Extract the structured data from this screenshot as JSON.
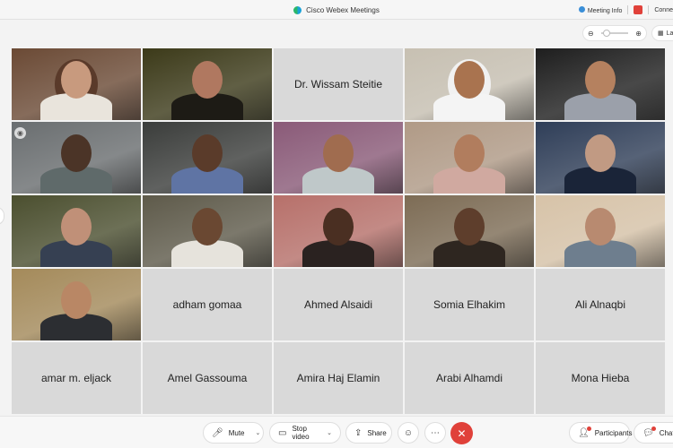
{
  "window": {
    "title": "Cisco Webex Meetings",
    "meeting_info_label": "Meeting Info",
    "connect_label": "Conne"
  },
  "view_controls": {
    "zoom_out_icon": "zoom-out-icon",
    "zoom_in_icon": "zoom-in-icon",
    "layout_label": "La"
  },
  "participants": [
    {
      "type": "video",
      "bg": "#6b4a35",
      "skin": "#c89a7e",
      "cloth": "#e9e4dc",
      "veil": "#5a3a2a"
    },
    {
      "type": "video",
      "bg": "#3c3a19",
      "skin": "#b07860",
      "cloth": "#1d1b15"
    },
    {
      "type": "name",
      "name": "Dr. Wissam Steitie"
    },
    {
      "type": "video",
      "bg": "#c7c0b2",
      "skin": "#a9734f",
      "cloth": "#f4f4f4",
      "veil": "#f1f1f1"
    },
    {
      "type": "video",
      "bg": "#1e1e1e",
      "skin": "#b5815f",
      "cloth": "#9ba0aa"
    },
    {
      "type": "video",
      "bg": "#6a6e70",
      "skin": "#4b3427",
      "cloth": "#5f6a6a",
      "pin": true
    },
    {
      "type": "video",
      "bg": "#3b3d3b",
      "skin": "#5a3b2a",
      "cloth": "#5f74a4"
    },
    {
      "type": "video",
      "bg": "#8a5a78",
      "skin": "#a06c4f",
      "cloth": "#bfc8c9"
    },
    {
      "type": "video",
      "bg": "#b09a86",
      "skin": "#b17d5e",
      "cloth": "#d0a9a0"
    },
    {
      "type": "video",
      "bg": "#2f3e58",
      "skin": "#c19a83",
      "cloth": "#1a2438"
    },
    {
      "type": "video",
      "bg": "#4b4f2f",
      "skin": "#c09078",
      "cloth": "#364052"
    },
    {
      "type": "video",
      "bg": "#5e5a4a",
      "skin": "#6a4832",
      "cloth": "#e6e3dc"
    },
    {
      "type": "video",
      "bg": "#b7706a",
      "skin": "#4a2f22",
      "cloth": "#2a2220"
    },
    {
      "type": "video",
      "bg": "#7d6c55",
      "skin": "#5e3e2c",
      "cloth": "#2e2620"
    },
    {
      "type": "video",
      "bg": "#d7c3a8",
      "skin": "#b88a70",
      "cloth": "#6e7e8e"
    },
    {
      "type": "video",
      "bg": "#a48a5a",
      "skin": "#b98765",
      "cloth": "#2c2e32"
    },
    {
      "type": "name",
      "name": "adham gomaa"
    },
    {
      "type": "name",
      "name": "Ahmed Alsaidi"
    },
    {
      "type": "name",
      "name": "Somia Elhakim"
    },
    {
      "type": "name",
      "name": "Ali Alnaqbi"
    },
    {
      "type": "name",
      "name": "amar m. eljack"
    },
    {
      "type": "name",
      "name": "Amel Gassouma"
    },
    {
      "type": "name",
      "name": "Amira Haj Elamin"
    },
    {
      "type": "name",
      "name": "Arabi Alhamdi"
    },
    {
      "type": "name",
      "name": "Mona Hieba"
    }
  ],
  "controls": {
    "mute_label": "Mute",
    "stop_video_label": "Stop video",
    "share_label": "Share",
    "participants_label": "Participants",
    "chat_label": "Chat",
    "leave_icon": "leave-icon"
  },
  "colors": {
    "leave": "#e0413a",
    "tile_empty": "#d9d9d9",
    "accent": "#3b8fd8"
  }
}
